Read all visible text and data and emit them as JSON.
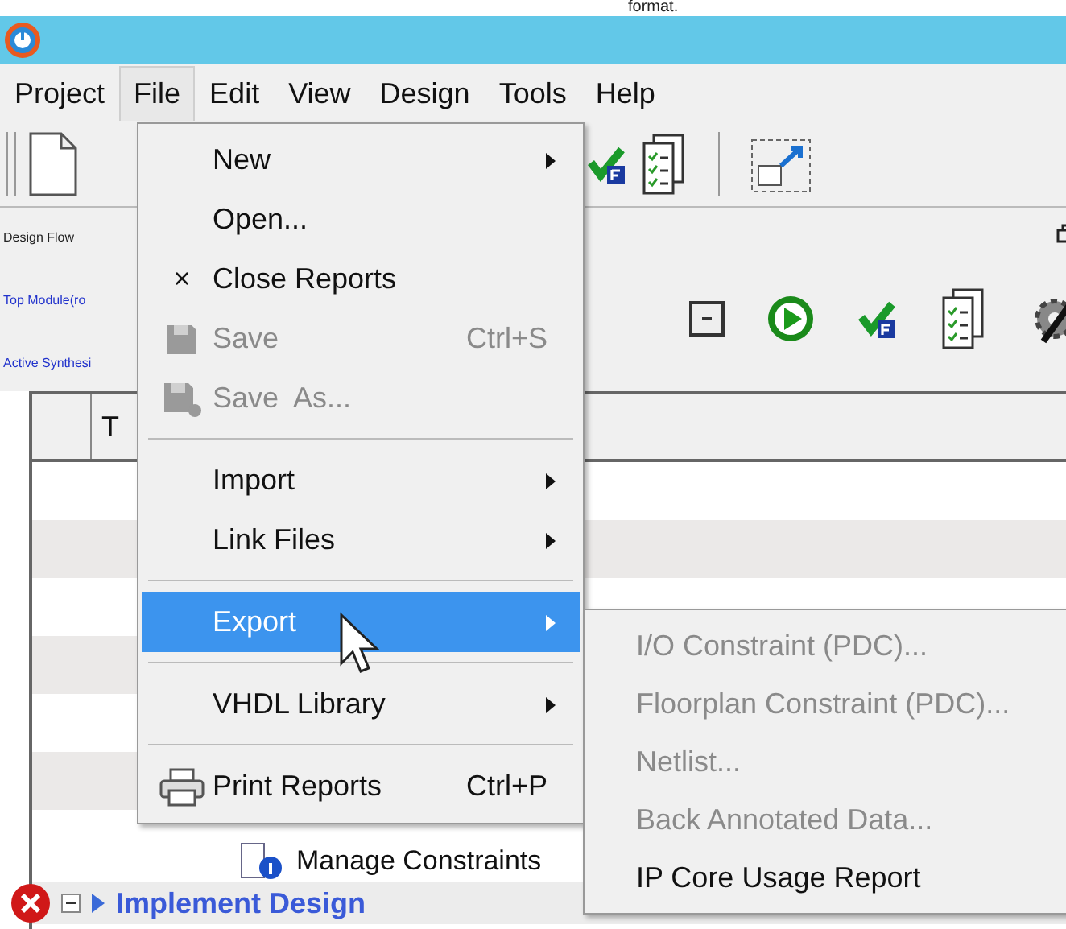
{
  "caption": "format.",
  "menubar": [
    {
      "label": "Project",
      "selected": false
    },
    {
      "label": "File",
      "selected": true
    },
    {
      "label": "Edit",
      "selected": false
    },
    {
      "label": "View",
      "selected": false
    },
    {
      "label": "Design",
      "selected": false
    },
    {
      "label": "Tools",
      "selected": false
    },
    {
      "label": "Help",
      "selected": false
    }
  ],
  "design_flow": {
    "title": "Design Flow",
    "fields": [
      "Top Module(ro",
      "Active Synthesi"
    ]
  },
  "flow_table": {
    "columns": [
      "T"
    ],
    "rows": [
      {
        "label": "Manage Constraints",
        "kind": "task",
        "error": false
      },
      {
        "label": "Implement Design",
        "kind": "process",
        "error": true
      }
    ]
  },
  "file_menu": [
    {
      "kind": "item",
      "label": "New",
      "submenu": true,
      "disabled": false,
      "selected": false
    },
    {
      "kind": "item",
      "label": "Open...",
      "submenu": false,
      "disabled": false,
      "selected": false
    },
    {
      "kind": "item",
      "label": "Close Reports",
      "glyph": "×",
      "submenu": false,
      "disabled": false,
      "selected": false
    },
    {
      "kind": "save",
      "label": "Save",
      "shortcut": "Ctrl+S",
      "submenu": false,
      "disabled": true,
      "selected": false
    },
    {
      "kind": "save_as",
      "label": "Save  As...",
      "submenu": false,
      "disabled": true,
      "selected": false
    },
    {
      "kind": "separator"
    },
    {
      "kind": "item",
      "label": "Import",
      "submenu": true,
      "disabled": false,
      "selected": false
    },
    {
      "kind": "item",
      "label": "Link Files",
      "submenu": true,
      "disabled": false,
      "selected": false
    },
    {
      "kind": "separator"
    },
    {
      "kind": "item",
      "label": "Export",
      "submenu": true,
      "disabled": false,
      "selected": true
    },
    {
      "kind": "separator"
    },
    {
      "kind": "item",
      "label": "VHDL Library",
      "submenu": true,
      "disabled": false,
      "selected": false
    },
    {
      "kind": "separator"
    },
    {
      "kind": "print",
      "label": "Print Reports",
      "shortcut": "Ctrl+P",
      "submenu": false,
      "disabled": false,
      "selected": false
    }
  ],
  "export_submenu": [
    {
      "label": "I/O Constraint (PDC)...",
      "disabled": true
    },
    {
      "label": "Floorplan Constraint (PDC)...",
      "disabled": true
    },
    {
      "label": "Netlist...",
      "disabled": true
    },
    {
      "label": "Back Annotated Data...",
      "disabled": true
    },
    {
      "label": "IP Core Usage Report",
      "disabled": false
    }
  ]
}
